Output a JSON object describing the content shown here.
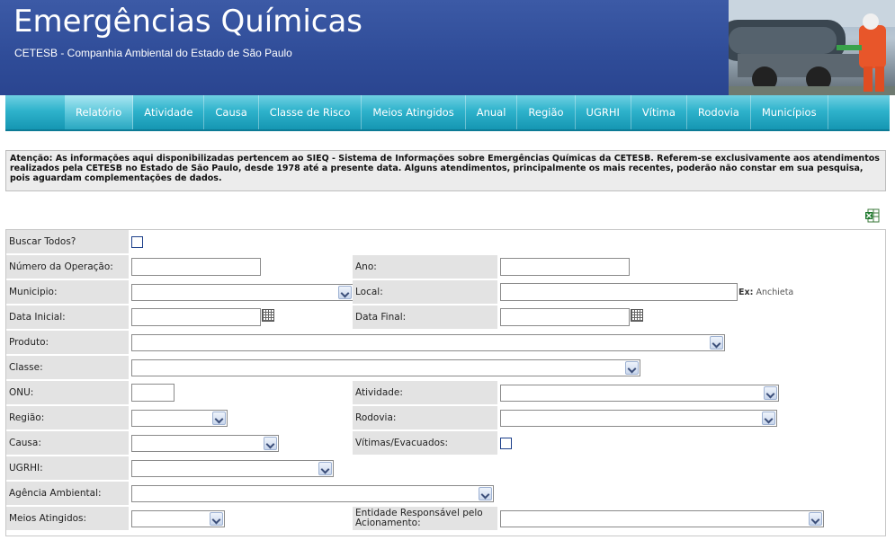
{
  "header": {
    "title": "Emergências Químicas",
    "subtitle": "CETESB - Companhia Ambiental do Estado de São Paulo"
  },
  "nav": {
    "items": [
      {
        "label": "Relatório",
        "active": true
      },
      {
        "label": "Atividade"
      },
      {
        "label": "Causa"
      },
      {
        "label": "Classe de Risco"
      },
      {
        "label": "Meios Atingidos"
      },
      {
        "label": "Anual"
      },
      {
        "label": "Região"
      },
      {
        "label": "UGRHI"
      },
      {
        "label": "Vítima"
      },
      {
        "label": "Rodovia"
      },
      {
        "label": "Municípios"
      }
    ]
  },
  "notice": {
    "text": "Atenção: As informações aqui disponibilizadas pertencem ao SIEQ - Sistema de Informações sobre Emergências Químicas da CETESB. Referem-se exclusivamente aos atendimentos realizados pela CETESB no Estado de São Paulo, desde 1978 até a presente data. Alguns atendimentos, principalmente os mais recentes, poderão não constar em sua pesquisa, pois aguardam complementações de dados."
  },
  "export": {
    "icon": "excel-icon"
  },
  "form": {
    "buscar_todos": "Buscar Todos?",
    "numero_operacao": "Número da Operação:",
    "ano": "Ano:",
    "municipio": "Municipio:",
    "local": "Local:",
    "local_hint_prefix": "Ex:",
    "local_hint": "Anchieta",
    "data_inicial": "Data Inicial:",
    "data_final": "Data Final:",
    "produto": "Produto:",
    "classe": "Classe:",
    "onu": "ONU:",
    "atividade": "Atividade:",
    "regiao": "Região:",
    "rodovia": "Rodovia:",
    "causa": "Causa:",
    "vitimas": "Vítimas/Evacuados:",
    "ugrhi": "UGRHI:",
    "agencia": "Agência Ambiental:",
    "meios": "Meios Atingidos:",
    "entidade": "Entidade Responsável pelo Acionamento:"
  },
  "colors": {
    "header_blue": "#2f4c98",
    "nav_teal": "#2fb3cc",
    "label_gray": "#e3e3e3"
  }
}
